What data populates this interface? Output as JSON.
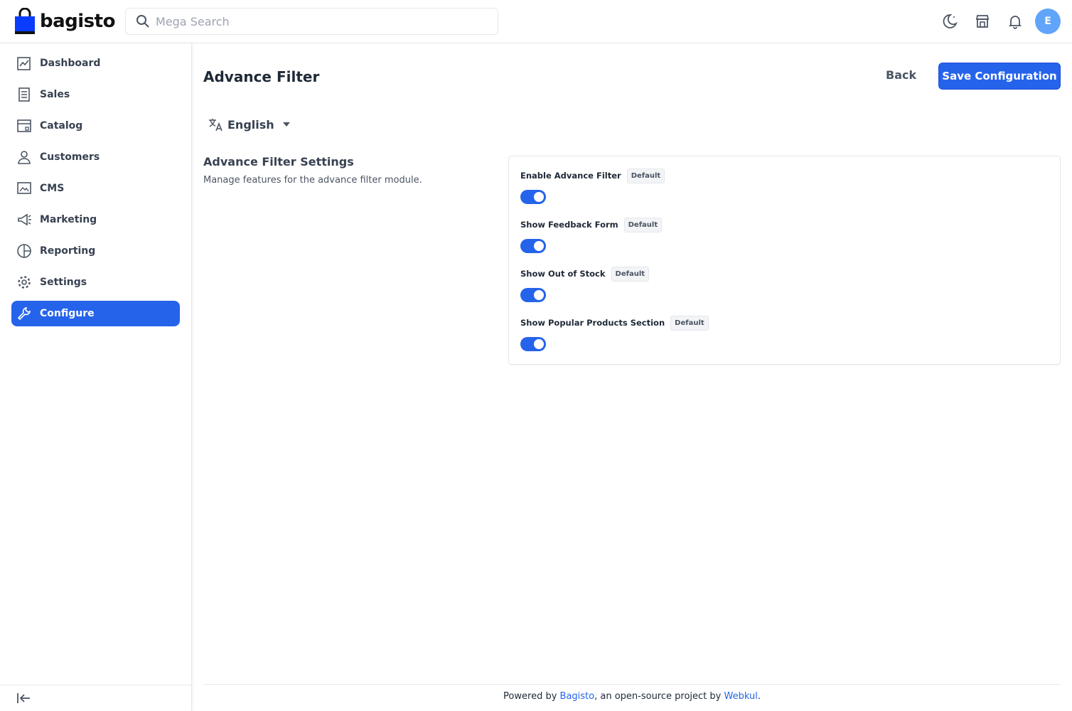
{
  "brand": {
    "name": "bagisto"
  },
  "search": {
    "placeholder": "Mega Search"
  },
  "header": {
    "icons": [
      "moon-icon",
      "store-icon",
      "bell-icon"
    ],
    "avatar_initial": "E"
  },
  "sidebar": {
    "items": [
      {
        "label": "Dashboard",
        "icon": "dashboard-icon"
      },
      {
        "label": "Sales",
        "icon": "sales-icon"
      },
      {
        "label": "Catalog",
        "icon": "catalog-icon"
      },
      {
        "label": "Customers",
        "icon": "customers-icon"
      },
      {
        "label": "CMS",
        "icon": "cms-icon"
      },
      {
        "label": "Marketing",
        "icon": "marketing-icon"
      },
      {
        "label": "Reporting",
        "icon": "reporting-icon"
      },
      {
        "label": "Settings",
        "icon": "settings-icon"
      },
      {
        "label": "Configure",
        "icon": "configure-icon",
        "active": true
      }
    ]
  },
  "page": {
    "title": "Advance Filter",
    "back_label": "Back",
    "save_label": "Save Configuration",
    "locale": "English"
  },
  "section": {
    "title": "Advance Filter Settings",
    "description": "Manage features for the advance filter module."
  },
  "fields": [
    {
      "label": "Enable Advance Filter",
      "badge": "Default",
      "enabled": true
    },
    {
      "label": "Show Feedback Form",
      "badge": "Default",
      "enabled": true
    },
    {
      "label": "Show Out of Stock",
      "badge": "Default",
      "enabled": true
    },
    {
      "label": "Show Popular Products Section",
      "badge": "Default",
      "enabled": true
    }
  ],
  "footer": {
    "prefix": "Powered by ",
    "link1": "Bagisto",
    "middle": ", an open-source project by ",
    "link2": "Webkul",
    "suffix": "."
  },
  "colors": {
    "accent": "#2563eb",
    "avatar": "#60a5fa"
  }
}
